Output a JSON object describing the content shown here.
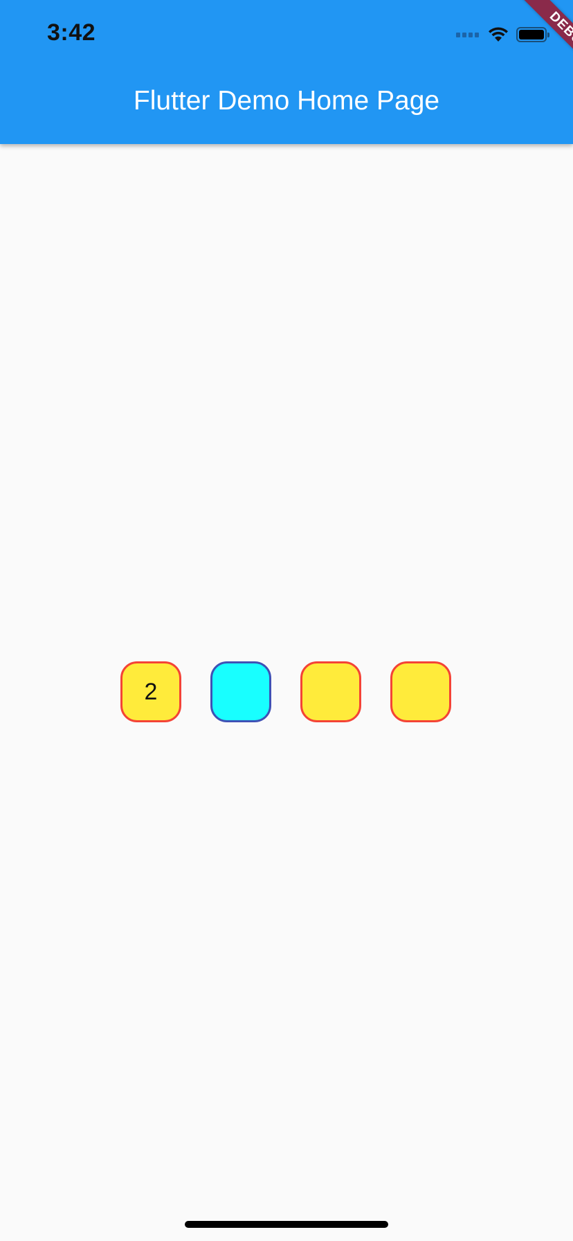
{
  "status_bar": {
    "time": "3:42"
  },
  "app_bar": {
    "title": "Flutter Demo Home Page",
    "color": "#2196F3"
  },
  "debug_banner": {
    "label": "DEBUG",
    "color": "#8A2A4A"
  },
  "boxes": [
    {
      "label": "2",
      "fill": "#FFEB3B",
      "border": "#F44336"
    },
    {
      "label": "",
      "fill": "#18FFFF",
      "border": "#3F51B5"
    },
    {
      "label": "",
      "fill": "#FFEB3B",
      "border": "#F44336"
    },
    {
      "label": "",
      "fill": "#FFEB3B",
      "border": "#F44336"
    }
  ],
  "icons": {
    "signal": "cellular-signal-icon",
    "wifi": "wifi-icon",
    "battery": "battery-icon"
  }
}
